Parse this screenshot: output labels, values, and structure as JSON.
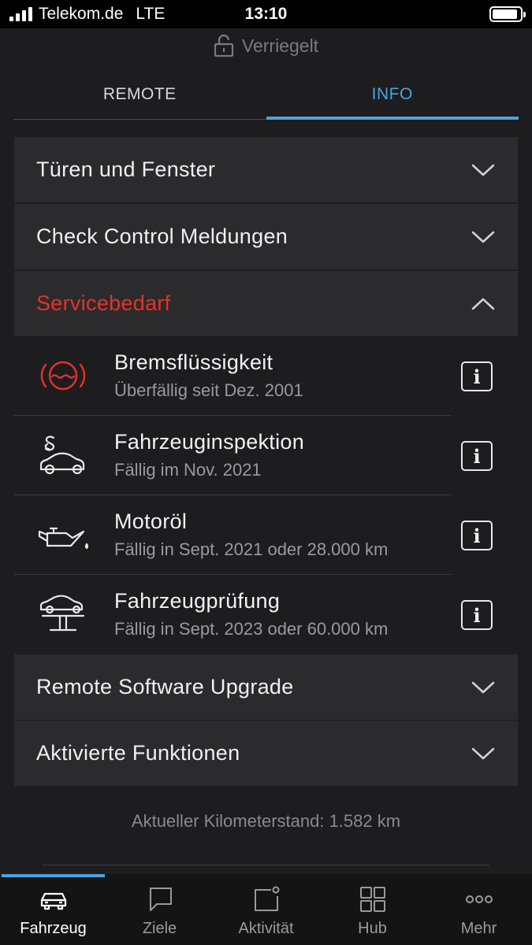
{
  "status_bar": {
    "carrier": "Telekom.de",
    "network": "LTE",
    "time": "13:10",
    "battery_level": 0.9
  },
  "lock_status": {
    "label": "Verriegelt",
    "icon": "lock-icon"
  },
  "tabs": [
    {
      "label": "REMOTE",
      "active": false
    },
    {
      "label": "INFO",
      "active": true
    }
  ],
  "sections": {
    "doors_windows": {
      "label": "Türen und Fenster",
      "expanded": false
    },
    "check_control": {
      "label": "Check Control Meldungen",
      "expanded": false
    },
    "service": {
      "label": "Servicebedarf",
      "expanded": true,
      "color": "#e63229"
    },
    "remote_upgrade": {
      "label": "Remote Software Upgrade",
      "expanded": false
    },
    "activated_functions": {
      "label": "Aktivierte Funktionen",
      "expanded": false
    }
  },
  "service_items": [
    {
      "title": "Bremsflüssigkeit",
      "subtitle": "Überfällig seit Dez. 2001",
      "icon": "brake-fluid-icon",
      "status_color": "#e63229"
    },
    {
      "title": "Fahrzeuginspektion",
      "subtitle": "Fällig im Nov. 2021",
      "icon": "vehicle-inspection-icon"
    },
    {
      "title": "Motoröl",
      "subtitle": "Fällig in Sept. 2021 oder 28.000 km",
      "icon": "engine-oil-icon"
    },
    {
      "title": "Fahrzeugprüfung",
      "subtitle": "Fällig in Sept. 2023 oder 60.000 km",
      "icon": "vehicle-lift-icon"
    }
  ],
  "odometer": "Aktueller Kilometerstand: 1.582 km",
  "bottom_nav": [
    {
      "label": "Fahrzeug",
      "icon": "car-icon",
      "active": true
    },
    {
      "label": "Ziele",
      "icon": "chat-bubble-icon",
      "active": false
    },
    {
      "label": "Aktivität",
      "icon": "notification-icon",
      "active": false
    },
    {
      "label": "Hub",
      "icon": "grid-icon",
      "active": false
    },
    {
      "label": "Mehr",
      "icon": "more-dots-icon",
      "active": false
    }
  ],
  "colors": {
    "accent": "#4aa4e0",
    "alert": "#e63229",
    "background": "#1d1d1f",
    "card": "#2b2b2d"
  }
}
